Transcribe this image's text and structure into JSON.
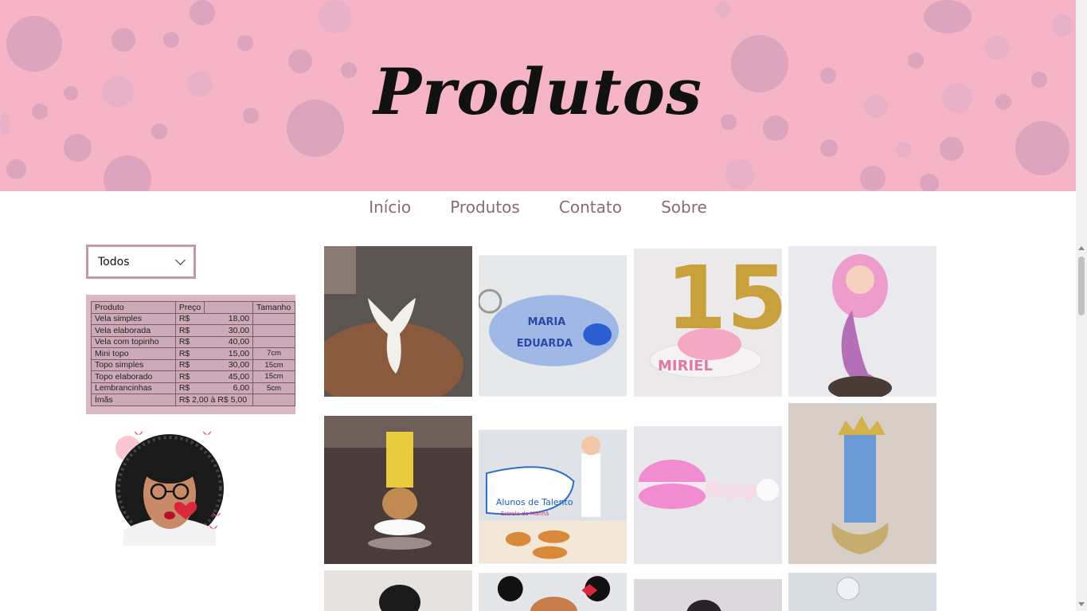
{
  "header": {
    "title": "Produtos"
  },
  "nav": {
    "items": [
      {
        "label": "Início"
      },
      {
        "label": "Produtos"
      },
      {
        "label": "Contato"
      },
      {
        "label": "Sobre"
      }
    ]
  },
  "filter": {
    "selected": "Todos",
    "icon": "chevron-down-icon"
  },
  "price_table": {
    "headers": [
      "Produto",
      "Preço",
      "",
      "Tamanho"
    ],
    "rows": [
      {
        "product": "Vela simples",
        "cur": "R$",
        "price": "18,00",
        "size": ""
      },
      {
        "product": "Vela elaborada",
        "cur": "R$",
        "price": "30,00",
        "size": ""
      },
      {
        "product": "Vela com topinho",
        "cur": "R$",
        "price": "40,00",
        "size": ""
      },
      {
        "product": "Mini topo",
        "cur": "R$",
        "price": "15,00",
        "size": "7cm"
      },
      {
        "product": "Topo simples",
        "cur": "R$",
        "price": "30,00",
        "size": "15cm"
      },
      {
        "product": "Topo elaborado",
        "cur": "R$",
        "price": "45,00",
        "size": "15cm"
      },
      {
        "product": "Lembrancinhas",
        "cur": "R$",
        "price": "6,00",
        "size": "5cm"
      },
      {
        "product": "Ímãs",
        "cur": "R$ 2,00 à R$ 5,00",
        "price": "",
        "size": ""
      }
    ]
  },
  "gallery": {
    "photos": [
      {
        "name": "white-dove-figure"
      },
      {
        "name": "keychain-maria-eduarda",
        "text1": "MARIA",
        "text2": "EDUARDA"
      },
      {
        "name": "number-15-topper",
        "text": "15",
        "sub": "MIRIEL"
      },
      {
        "name": "mermaid-figure"
      },
      {
        "name": "number-1-bear-candle"
      },
      {
        "name": "chef-figure-alunos-de-talento",
        "text1": "Alunos de Talento",
        "text2": "Estrela da Manhã"
      },
      {
        "name": "macaron-with-pearls"
      },
      {
        "name": "number-1-blue-crown-candle"
      },
      {
        "name": "boy-figure"
      },
      {
        "name": "minnie-figure"
      },
      {
        "name": "dark-figure"
      },
      {
        "name": "glass-figure"
      }
    ]
  },
  "colors": {
    "banner": "#f6b5c6",
    "nav_text": "#8a6a78",
    "select_border": "#c19aaa"
  }
}
